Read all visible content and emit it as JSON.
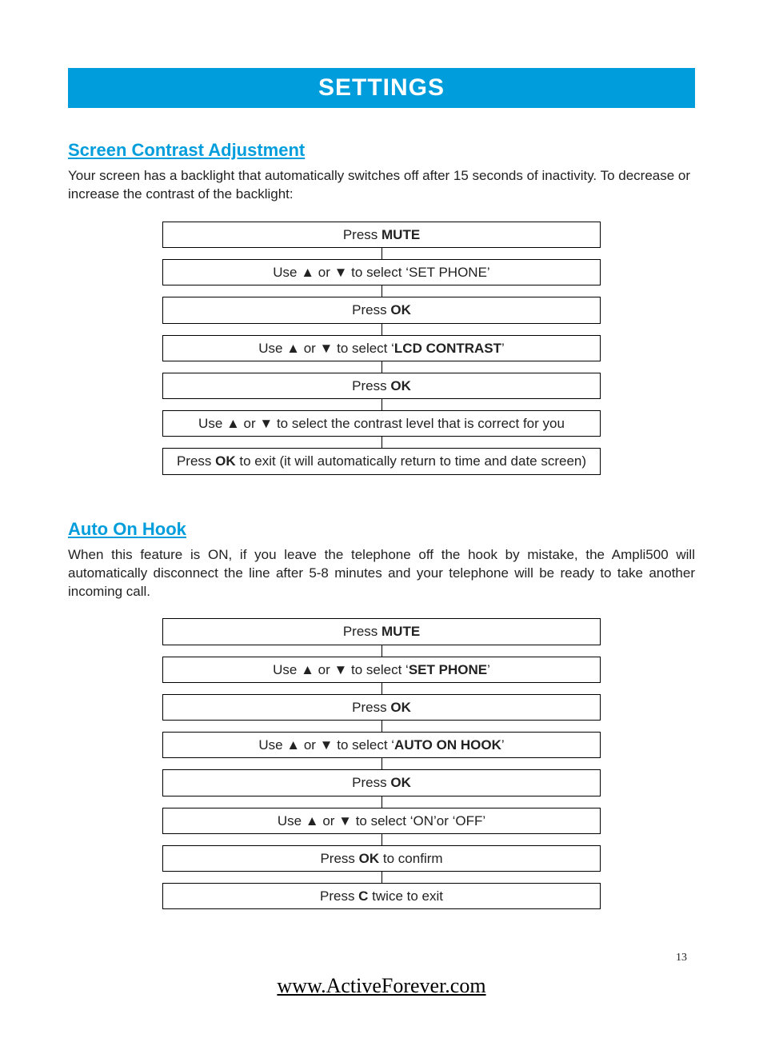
{
  "title": "SETTINGS",
  "pageNumber": "13",
  "footerLink": "www.ActiveForever.com",
  "sections": [
    {
      "heading": "Screen Contrast Adjustment",
      "paragraph": "Your screen has a backlight that automatically switches off after 15 seconds of inactivity. To decrease or increase the contrast of the backlight:",
      "justify": false,
      "steps": [
        {
          "pre": "Press ",
          "bold": "MUTE",
          "post": ""
        },
        {
          "pre": "Use ▲ or ▼ to select ‘SET PHONE’",
          "bold": "",
          "post": ""
        },
        {
          "pre": "Press ",
          "bold": "OK",
          "post": ""
        },
        {
          "pre": "Use ▲ or ▼ to select ‘",
          "bold": "LCD CONTRAST",
          "post": "’"
        },
        {
          "pre": "Press ",
          "bold": "OK",
          "post": ""
        },
        {
          "pre": "Use ▲ or ▼ to select the contrast level that is correct for you",
          "bold": "",
          "post": ""
        },
        {
          "pre": "Press ",
          "bold": "OK",
          "post": " to exit (it will automatically return to time and date screen)"
        }
      ]
    },
    {
      "heading": "Auto On Hook",
      "paragraph": "When this feature is ON, if you leave the telephone off the hook by mistake, the Ampli500 will automatically disconnect the line after 5-8 minutes and your telephone will be ready to take another incoming call.",
      "justify": true,
      "steps": [
        {
          "pre": "Press ",
          "bold": "MUTE",
          "post": ""
        },
        {
          "pre": "Use ▲ or ▼ to select ‘",
          "bold": "SET PHONE",
          "post": "’"
        },
        {
          "pre": "Press ",
          "bold": "OK",
          "post": ""
        },
        {
          "pre": "Use ▲ or ▼ to select ‘",
          "bold": "AUTO ON HOOK",
          "post": "’"
        },
        {
          "pre": "Press ",
          "bold": "OK",
          "post": ""
        },
        {
          "pre": "Use ▲ or ▼ to select ‘ON’or ‘OFF’",
          "bold": "",
          "post": ""
        },
        {
          "pre": "Press ",
          "bold": "OK",
          "post": " to conﬁrm"
        },
        {
          "pre": "Press ",
          "bold": "C",
          "post": " twice to exit"
        }
      ]
    }
  ]
}
